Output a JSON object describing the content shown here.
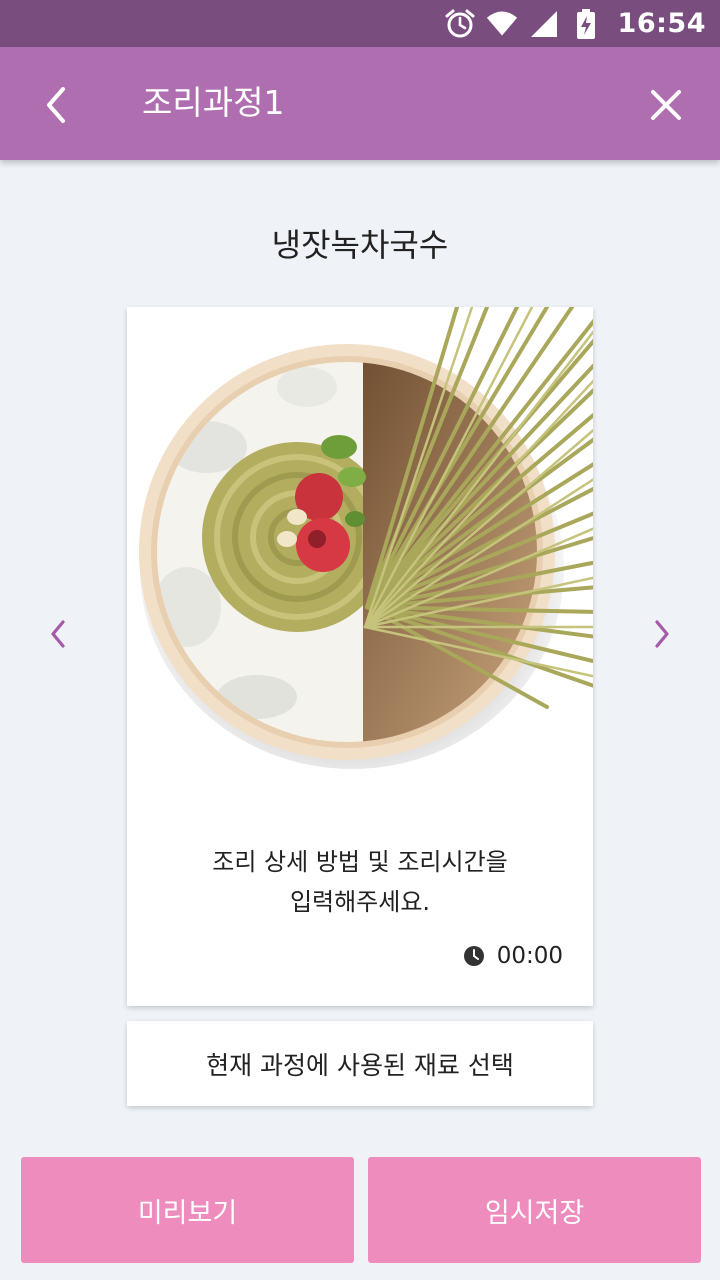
{
  "status_bar": {
    "time": "16:54",
    "icons": [
      "alarm-icon",
      "wifi-icon",
      "signal-icon",
      "battery-charging-icon"
    ]
  },
  "app_bar": {
    "title": "조리과정1",
    "back_icon": "chevron-left-icon",
    "close_icon": "close-icon"
  },
  "recipe": {
    "name": "냉잣녹차국수"
  },
  "step_card": {
    "description_line1": "조리 상세 방법 및 조리시간을",
    "description_line2": "입력해주세요.",
    "timer_icon": "clock-icon",
    "timer_value": "00:00"
  },
  "nav": {
    "prev_icon": "chevron-left-icon",
    "next_icon": "chevron-right-icon"
  },
  "ingredient_select_label": "현재 과정에 사용된 재료 선택",
  "buttons": {
    "preview_label": "미리보기",
    "save_label": "임시저장"
  },
  "colors": {
    "status_bar": "#7a4d7f",
    "app_bar": "#af6eb0",
    "accent_arrow": "#a55aa7",
    "button_pink": "#ee8cbd",
    "background": "#eff3f7"
  }
}
